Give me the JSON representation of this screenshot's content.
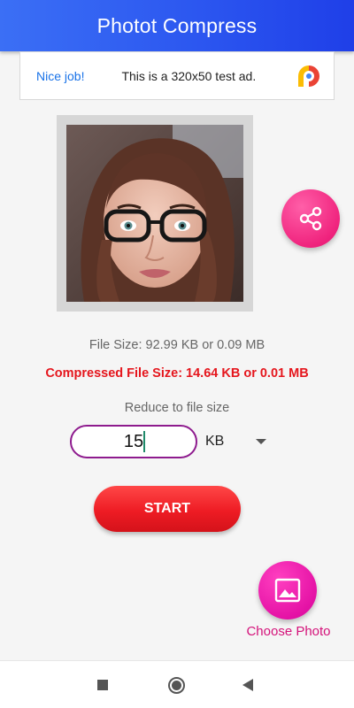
{
  "app_bar": {
    "title": "Photot Compress"
  },
  "ad": {
    "nice_label": "Nice job!",
    "text": "This is a 320x50 test ad.",
    "logo_icon": "adchoices-logo-icon"
  },
  "photo": {
    "subject": "portrait-photo"
  },
  "share": {
    "icon": "share-icon"
  },
  "info": {
    "file_size": "File Size: 92.99 KB or 0.09 MB",
    "compressed_size": "Compressed File Size: 14.64 KB or 0.01 MB",
    "reduce_label": "Reduce to file size"
  },
  "size_input": {
    "value": "15"
  },
  "unit": {
    "selected": "KB"
  },
  "start_button": {
    "label": "START"
  },
  "choose_photo": {
    "label": "Choose Photo",
    "icon": "image-icon"
  },
  "colors": {
    "app_bar": "#2c57f0",
    "accent_pink": "#f0247e",
    "start_red": "#ee1c24",
    "compressed_text": "#e5161d",
    "input_border": "#8e1b8e"
  },
  "nav": {
    "items": [
      "recents-icon",
      "home-icon",
      "back-icon"
    ]
  }
}
